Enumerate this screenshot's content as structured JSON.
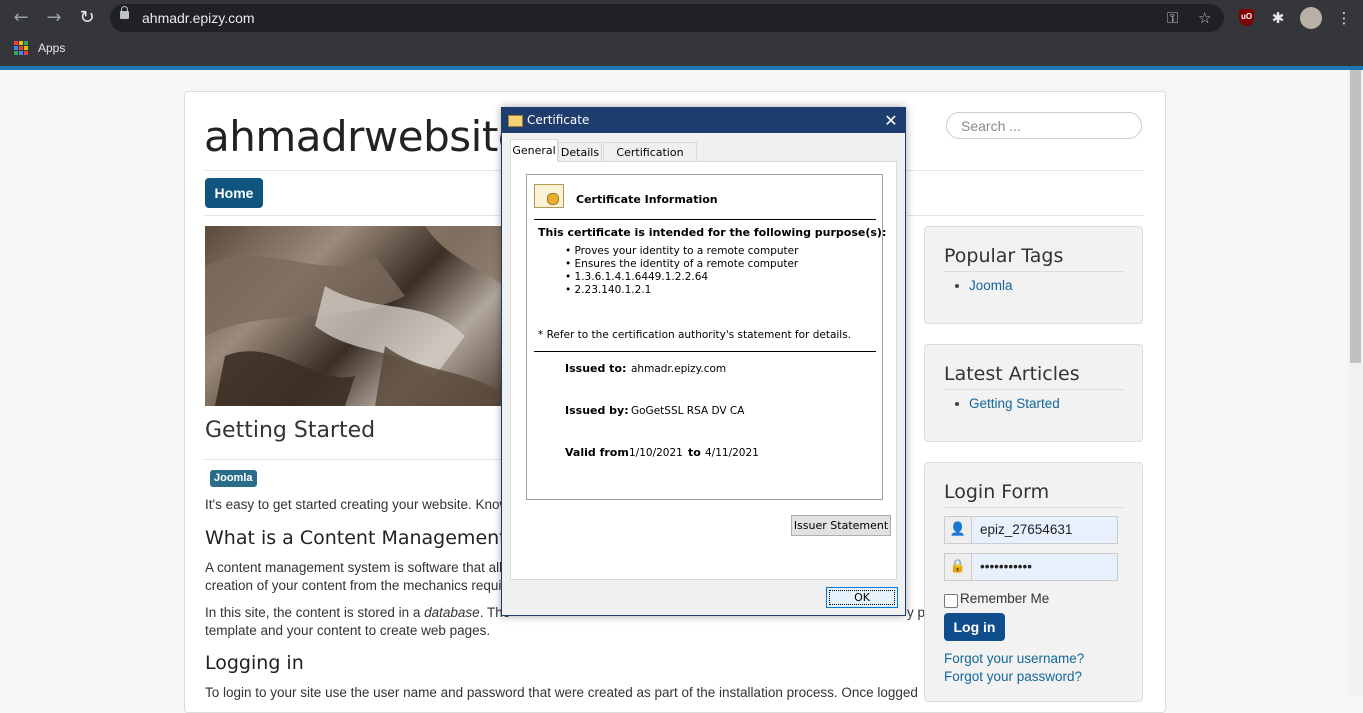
{
  "browser": {
    "url": "ahmadr.epizy.com",
    "back_icon": "←",
    "forward_icon": "→",
    "reload_icon": "↻",
    "key_icon": "⚿",
    "star_icon": "☆",
    "puzzle_icon": "✱",
    "menu_icon": "⋮",
    "ublock_label": "uO",
    "bookmarks": {
      "apps_label": "Apps"
    },
    "colors": {
      "toolbar": "#35363a",
      "omnibox": "#202124",
      "accent_line": "#1e76b2"
    }
  },
  "site": {
    "name": "ahmadrwebsites",
    "search_placeholder": "Search ...",
    "nav": {
      "home_label": "Home"
    },
    "article": {
      "title": "Getting Started",
      "tag": "Joomla",
      "intro": "It's easy to get started creating your website. Knowi",
      "section1_title": "What is a Content Management Sys",
      "section1_p1_line1": "A content management system is software that allov",
      "section1_p1_line2": "creation of your content from the mechanics require",
      "section1_p2_start": "In this site, the content is stored in a ",
      "section1_p2_italic": "database",
      "section1_p2_end": ". The",
      "section1_p2_right": "y                   p                              g     g",
      "section1_p2_line2": "template and your content to create web pages.",
      "section2_title": "Logging in",
      "section2_p1": "To login to your site use the user name and password that were created as part of the installation process. Once logged"
    },
    "sidebar": {
      "popular_tags": {
        "title": "Popular Tags",
        "items": [
          "Joomla"
        ]
      },
      "latest_articles": {
        "title": "Latest Articles",
        "items": [
          "Getting Started"
        ]
      },
      "login_form": {
        "title": "Login Form",
        "username_value": "epiz_27654631",
        "password_value": "•••••••••••",
        "user_icon": "👤",
        "lock_icon": "🔒",
        "remember_label": "Remember Me",
        "login_button": "Log in",
        "forgot_username": "Forgot your username?",
        "forgot_password": "Forgot your password?"
      }
    },
    "colors": {
      "primary": "#10557f",
      "link": "#13679a",
      "tag": "#2a6d8a"
    }
  },
  "dialog": {
    "title": "Certificate",
    "close_icon": "✕",
    "tabs": [
      "General",
      "Details",
      "Certification Path"
    ],
    "heading": "Certificate Information",
    "purpose_heading": "This certificate is intended for the following purpose(s):",
    "purposes": [
      "• Proves your identity to a remote computer",
      "• Ensures the identity of a remote computer",
      "• 1.3.6.1.4.1.6449.1.2.2.64",
      "• 2.23.140.1.2.1"
    ],
    "note": "* Refer to the certification authority's statement for details.",
    "issued_to_label": "Issued to:",
    "issued_to_value": "ahmadr.epizy.com",
    "issued_by_label": "Issued by:",
    "issued_by_value": "GoGetSSL RSA DV CA",
    "valid_from_label": "Valid from",
    "valid_from_value": "1/10/2021",
    "valid_to_label": "to",
    "valid_to_value": "4/11/2021",
    "issuer_button": "Issuer Statement",
    "ok_button": "OK"
  }
}
